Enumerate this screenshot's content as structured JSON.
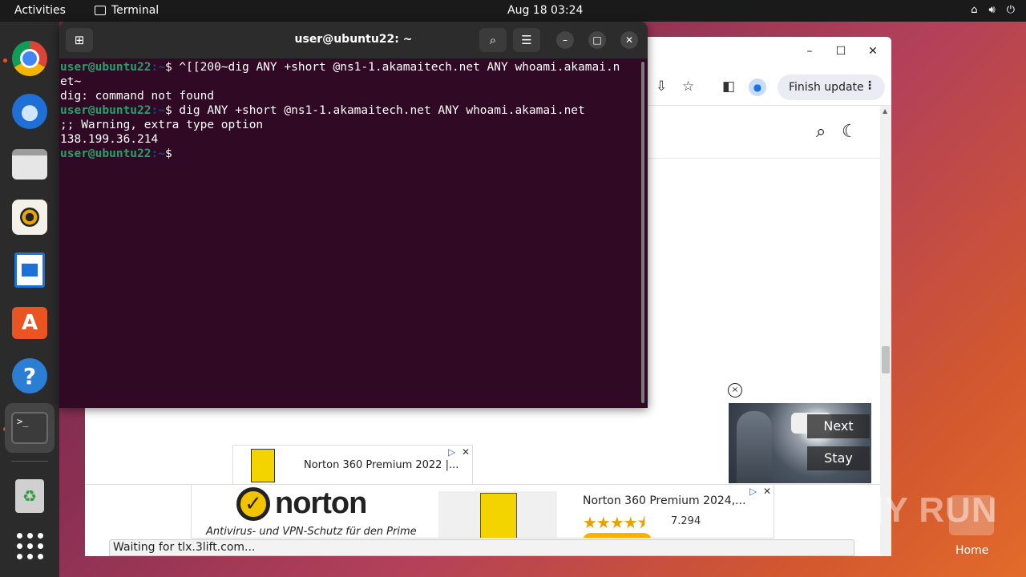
{
  "topbar": {
    "activities": "Activities",
    "app_name": "Terminal",
    "clock": "Aug 18  03:24"
  },
  "dock": {
    "items": [
      "chrome-icon",
      "thunderbird-icon",
      "files-icon",
      "rhythmbox-icon",
      "libreoffice-writer-icon",
      "app-center-icon",
      "help-icon",
      "terminal-icon",
      "trash-icon",
      "show-apps-icon"
    ]
  },
  "terminal": {
    "title": "user@ubuntu22: ~",
    "prompt_user": "user@ubuntu22",
    "prompt_path": ":~",
    "lines": [
      {
        "type": "prompt",
        "cmd": "$ ^[[200~dig ANY +short @ns1-1.akamaitech.net ANY whoami.akamai.n"
      },
      {
        "type": "output",
        "text": "et~"
      },
      {
        "type": "output",
        "text": "dig: command not found"
      },
      {
        "type": "prompt",
        "cmd": "$ dig ANY +short @ns1-1.akamaitech.net ANY whoami.akamai.net"
      },
      {
        "type": "output",
        "text": ";; Warning, extra type option"
      },
      {
        "type": "output",
        "text": "138.199.36.214"
      },
      {
        "type": "prompt",
        "cmd": "$"
      }
    ]
  },
  "browser": {
    "finish_update": "Finish update",
    "video_next": "Next",
    "video_stay": "Stay",
    "ad_inline_title": "Norton 360 Premium 2022 |...",
    "ad_brand": "norton",
    "ad_tagline": "Antivirus- und VPN-Schutz für den Prime",
    "ad_product_title": "Norton 360 Premium 2024,...",
    "ad_rating_value": "7.294",
    "ad_stars": 4.5,
    "status": "Waiting for tlx.3lift.com..."
  },
  "watermark": {
    "text": "ANY RUN",
    "home_label": "Home"
  },
  "colors": {
    "terminal_bg": "#300a24",
    "prompt_user": "#26a269",
    "prompt_path": "#12488b",
    "ubuntu_orange": "#e95420"
  }
}
